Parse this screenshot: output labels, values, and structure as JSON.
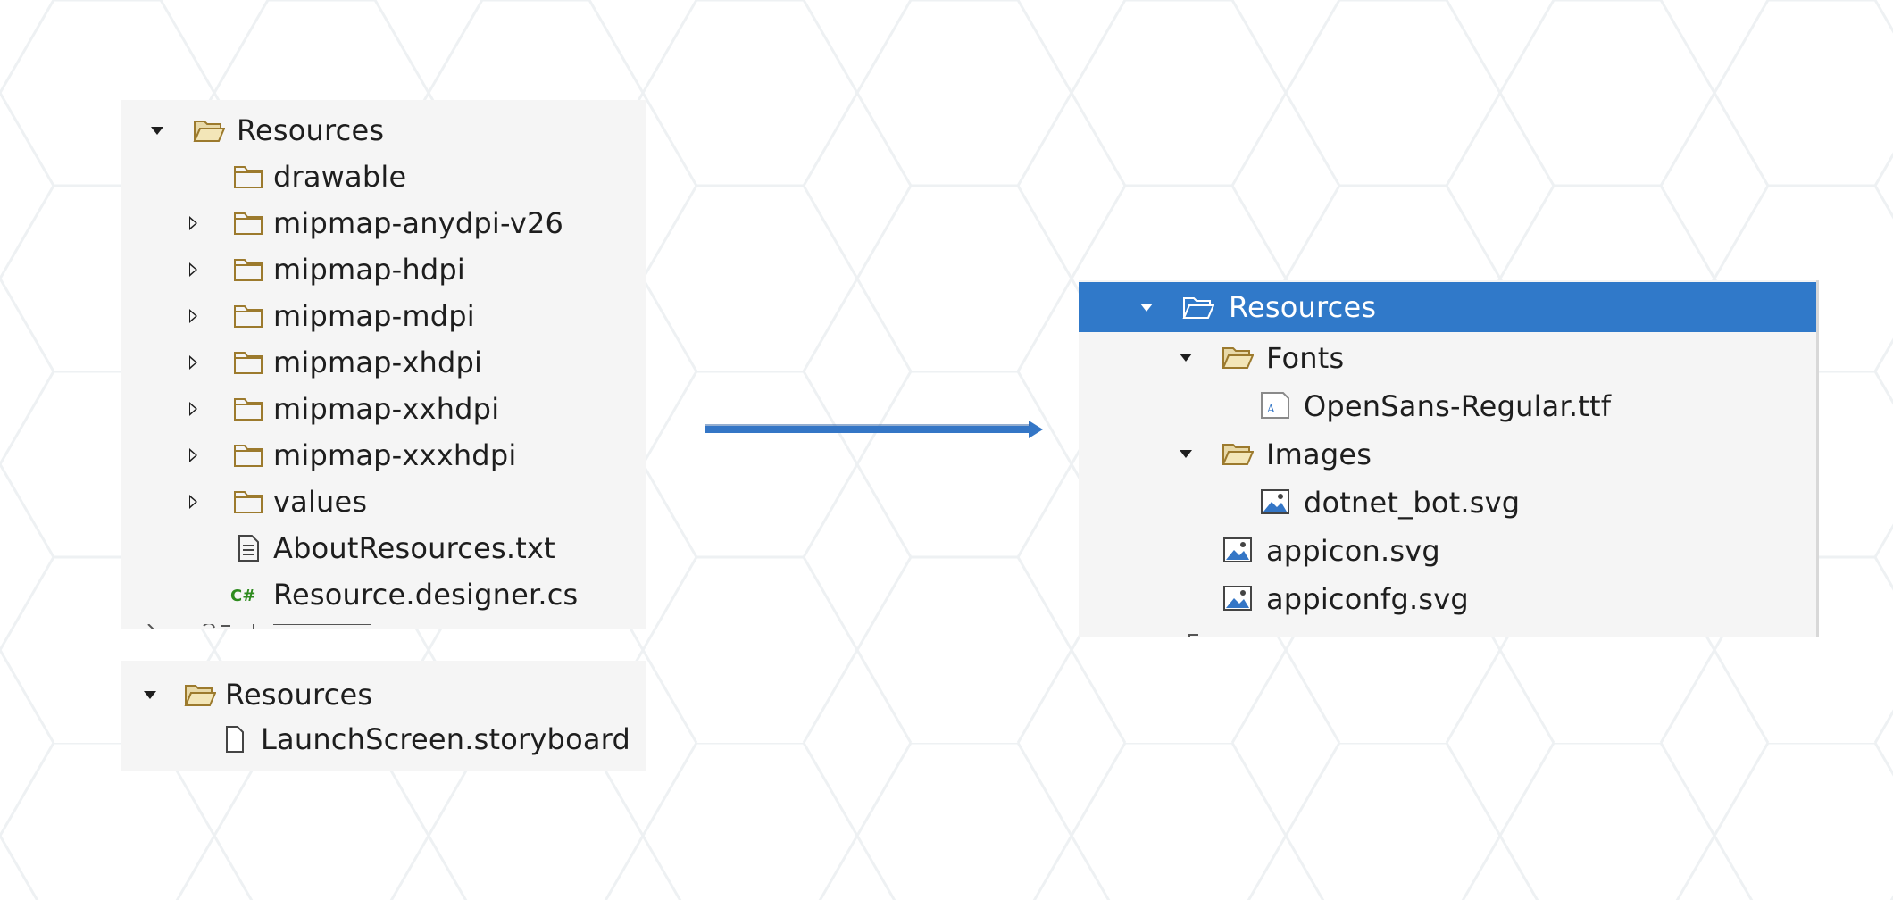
{
  "colors": {
    "panel_bg": "#f5f5f5",
    "selection_bg": "#3079c9",
    "folder_stroke": "#9c7a2d",
    "folder_fill": "#e8d9a8",
    "arrow": "#3476c6",
    "csharp_green": "#2e8b1e"
  },
  "android_panel": {
    "root": {
      "label": "Resources",
      "icon": "open-folder-icon",
      "expanded": true
    },
    "items": [
      {
        "label": "drawable",
        "icon": "folder-icon",
        "has_toggle": false
      },
      {
        "label": "mipmap-anydpi-v26",
        "icon": "folder-icon",
        "has_toggle": true
      },
      {
        "label": "mipmap-hdpi",
        "icon": "folder-icon",
        "has_toggle": true
      },
      {
        "label": "mipmap-mdpi",
        "icon": "folder-icon",
        "has_toggle": true
      },
      {
        "label": "mipmap-xhdpi",
        "icon": "folder-icon",
        "has_toggle": true
      },
      {
        "label": "mipmap-xxhdpi",
        "icon": "folder-icon",
        "has_toggle": true
      },
      {
        "label": "mipmap-xxxhdpi",
        "icon": "folder-icon",
        "has_toggle": true
      },
      {
        "label": "values",
        "icon": "folder-icon",
        "has_toggle": true
      },
      {
        "label": "AboutResources.txt",
        "icon": "text-file-icon",
        "has_toggle": false
      },
      {
        "label": "Resource.designer.cs",
        "icon": "csharp-file-icon",
        "has_toggle": false
      }
    ]
  },
  "ios_panel": {
    "root": {
      "label": "Resources",
      "icon": "open-folder-icon",
      "expanded": true
    },
    "items": [
      {
        "label": "LaunchScreen.storyboard",
        "icon": "file-icon"
      }
    ]
  },
  "maui_panel": {
    "root": {
      "label": "Resources",
      "icon": "open-folder-icon",
      "expanded": true,
      "selected": true
    },
    "fonts": {
      "label": "Fonts",
      "icon": "open-folder-icon",
      "expanded": true
    },
    "font_file": {
      "label": "OpenSans-Regular.ttf",
      "icon": "font-file-icon"
    },
    "images": {
      "label": "Images",
      "icon": "open-folder-icon",
      "expanded": true
    },
    "image_file": {
      "label": "dotnet_bot.svg",
      "icon": "image-file-icon"
    },
    "appicon": {
      "label": "appicon.svg",
      "icon": "image-file-icon"
    },
    "appiconfg": {
      "label": "appiconfg.svg",
      "icon": "image-file-icon"
    }
  }
}
